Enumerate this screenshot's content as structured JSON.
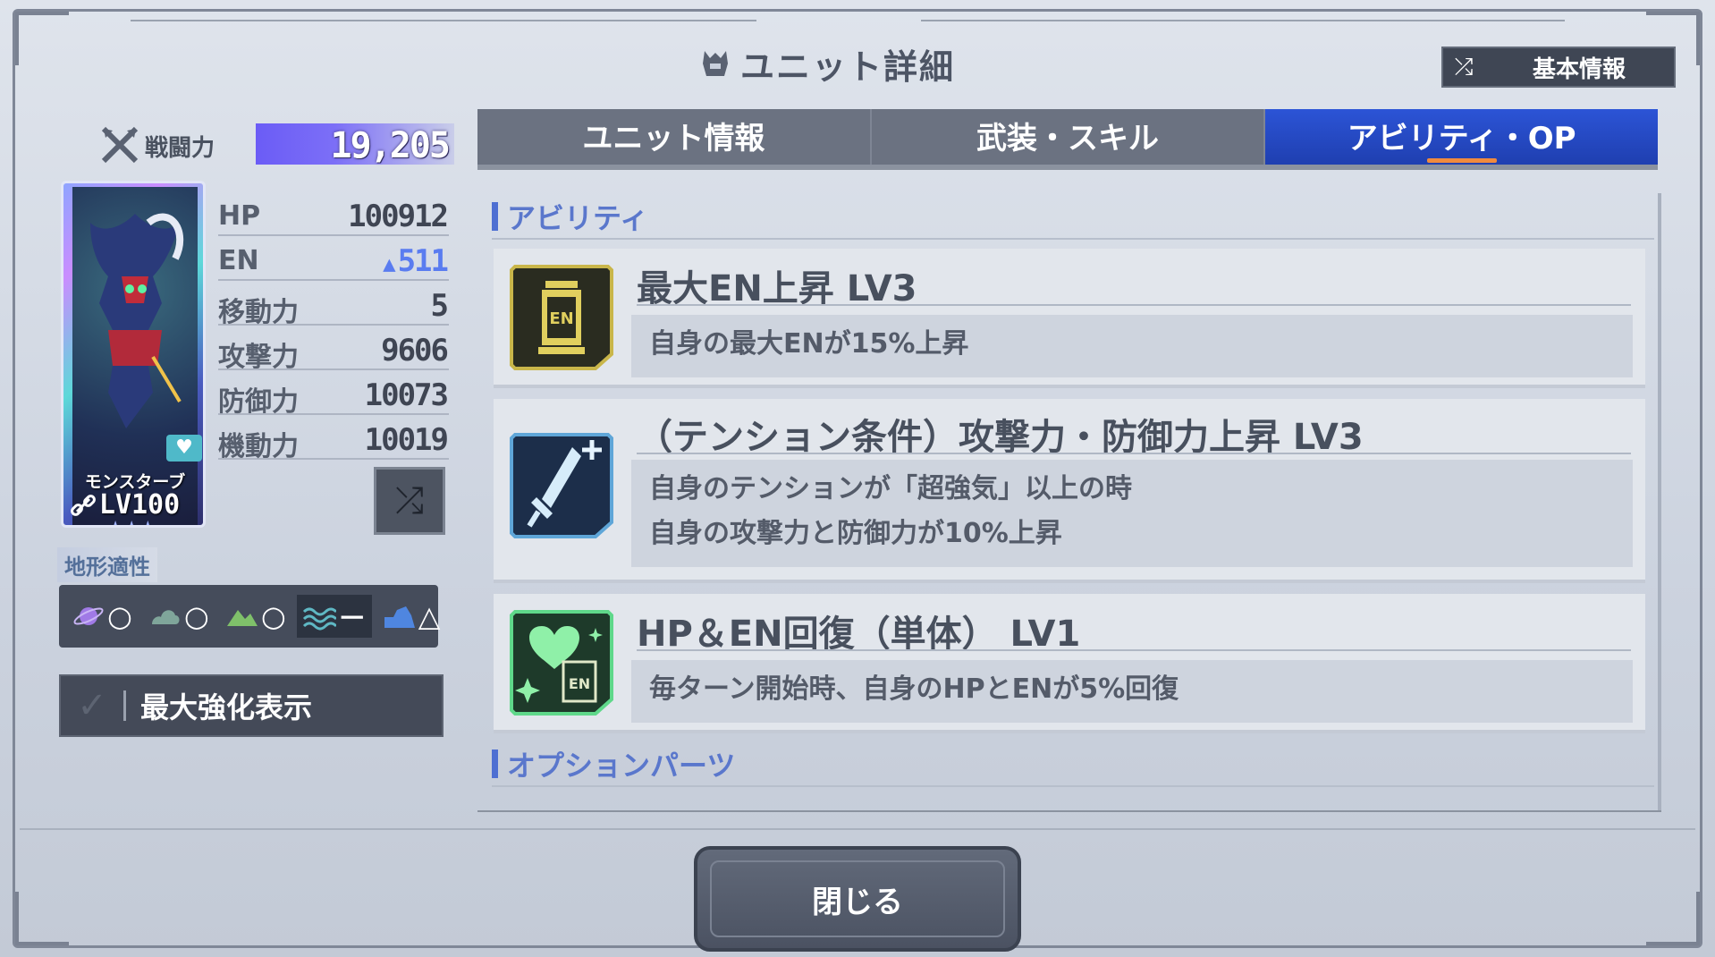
{
  "header": {
    "title": "ユニット詳細",
    "basic_info_label": "基本情報"
  },
  "combat_power": {
    "label": "戦闘力",
    "value": "19,205"
  },
  "unit": {
    "name": "モンスターブ",
    "level": "LV100",
    "stars": "★★★"
  },
  "stats": [
    {
      "label": "HP",
      "value": "100912"
    },
    {
      "label": "EN",
      "value": "511",
      "boosted": true
    },
    {
      "label": "移動力",
      "value": "5"
    },
    {
      "label": "攻撃力",
      "value": "9606"
    },
    {
      "label": "防御力",
      "value": "10073"
    },
    {
      "label": "機動力",
      "value": "10019"
    }
  ],
  "terrain": {
    "label": "地形適性",
    "ranks": [
      {
        "icon": "space-icon",
        "rank": "○"
      },
      {
        "icon": "air-icon",
        "rank": "○"
      },
      {
        "icon": "land-icon",
        "rank": "○"
      },
      {
        "icon": "water-icon",
        "rank": "－"
      },
      {
        "icon": "underground-icon",
        "rank": "△"
      }
    ]
  },
  "max_enhance_label": "最大強化表示",
  "tabs": [
    {
      "label": "ユニット情報",
      "active": false
    },
    {
      "label": "武装・スキル",
      "active": false
    },
    {
      "label": "アビリティ・OP",
      "active": true
    }
  ],
  "sections": {
    "ability": "アビリティ",
    "option_parts": "オプションパーツ"
  },
  "abilities": [
    {
      "icon": "en-tank-icon",
      "name": "最大EN上昇 LV3",
      "desc": [
        "自身の最大ENが15%上昇"
      ]
    },
    {
      "icon": "sword-plus-icon",
      "name": "（テンション条件）攻撃力・防御力上昇 LV3",
      "desc": [
        "自身のテンションが「超強気」以上の時",
        "自身の攻撃力と防御力が10%上昇"
      ]
    },
    {
      "icon": "heart-en-icon",
      "name": "HP＆EN回復（単体） LV1",
      "desc": [
        "毎ターン開始時、自身のHPとENが5%回復"
      ]
    }
  ],
  "close_label": "閉じる",
  "colors": {
    "active_tab": "#2c54d6",
    "accent": "#f08a3e",
    "section_title": "#5a77cc"
  }
}
